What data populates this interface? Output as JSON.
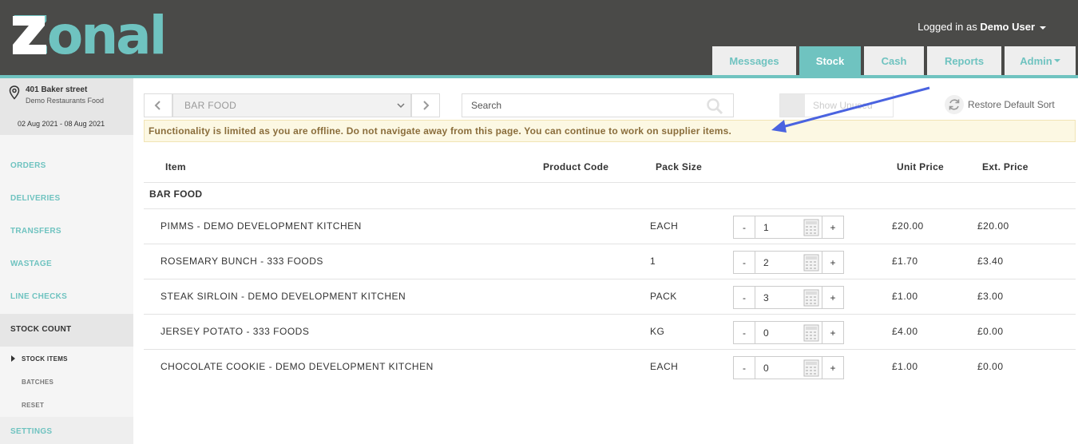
{
  "header": {
    "logo_text": "Zonal",
    "user_prefix": "Logged in as",
    "user_name": "Demo User",
    "tabs": [
      {
        "label": "Messages"
      },
      {
        "label": "Stock"
      },
      {
        "label": "Cash"
      },
      {
        "label": "Reports"
      },
      {
        "label": "Admin"
      }
    ],
    "accent_color": "#6fc3c0",
    "header_color": "#4a4a48"
  },
  "sidebar": {
    "location": {
      "address": "401 Baker street",
      "site": "Demo Restaurants Food",
      "dates": "02 Aug 2021 - 08 Aug 2021"
    },
    "items": [
      {
        "label": "ORDERS"
      },
      {
        "label": "DELIVERIES"
      },
      {
        "label": "TRANSFERS"
      },
      {
        "label": "WASTAGE"
      },
      {
        "label": "LINE CHECKS"
      },
      {
        "label": "STOCK COUNT"
      }
    ],
    "subitems": [
      {
        "label": "STOCK ITEMS"
      },
      {
        "label": "BATCHES"
      },
      {
        "label": "RESET"
      }
    ],
    "settings_label": "SETTINGS"
  },
  "toolbar": {
    "category": "BAR FOOD",
    "search_placeholder": "Search",
    "show_unused": "Show Unused",
    "restore": "Restore Default Sort"
  },
  "notice": "Functionality is limited as you are offline. Do not navigate away from this page. You can continue to work on supplier items.",
  "table": {
    "headers": {
      "item": "Item",
      "code": "Product Code",
      "pack": "Pack Size",
      "unit": "Unit Price",
      "ext": "Ext. Price"
    },
    "group": "BAR FOOD",
    "rows": [
      {
        "item": "PIMMS - DEMO DEVELOPMENT KITCHEN",
        "pack": "EACH",
        "qty": "1",
        "unit": "£20.00",
        "ext": "£20.00"
      },
      {
        "item": "ROSEMARY BUNCH - 333 FOODS",
        "pack": "1",
        "qty": "2",
        "unit": "£1.70",
        "ext": "£3.40"
      },
      {
        "item": "STEAK SIRLOIN - DEMO DEVELOPMENT KITCHEN",
        "pack": "PACK",
        "qty": "3",
        "unit": "£1.00",
        "ext": "£3.00"
      },
      {
        "item": "JERSEY POTATO - 333 FOODS",
        "pack": "KG",
        "qty": "0",
        "unit": "£4.00",
        "ext": "£0.00"
      },
      {
        "item": "CHOCOLATE COOKIE - DEMO DEVELOPMENT KITCHEN",
        "pack": "EACH",
        "qty": "0",
        "unit": "£1.00",
        "ext": "£0.00"
      }
    ],
    "minus_label": "-",
    "plus_label": "+"
  }
}
